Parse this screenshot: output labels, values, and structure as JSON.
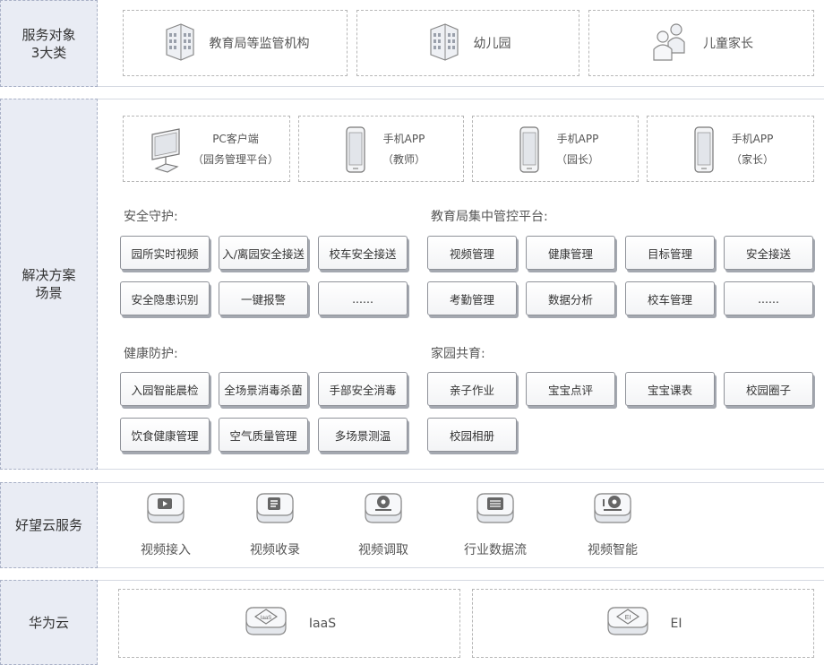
{
  "rows": {
    "targets": "服务对象\n3大类",
    "solutions": "解决方案\n场景",
    "cloud_service": "好望云服务",
    "huawei": "华为云"
  },
  "targets": [
    {
      "label": "教育局等监管机构",
      "icon": "building-icon"
    },
    {
      "label": "幼儿园",
      "icon": "building-icon"
    },
    {
      "label": "儿童家长",
      "icon": "people-icon"
    }
  ],
  "devices": [
    {
      "line1": "PC客户端",
      "line2": "（园务管理平台）",
      "icon": "monitor-icon"
    },
    {
      "line1": "手机APP",
      "line2": "（教师）",
      "icon": "phone-icon"
    },
    {
      "line1": "手机APP",
      "line2": "（园长）",
      "icon": "phone-icon"
    },
    {
      "line1": "手机APP",
      "line2": "（家长）",
      "icon": "phone-icon"
    }
  ],
  "safety": {
    "title": "安全守护:",
    "items": [
      "园所实时视频",
      "入/离园安全接送",
      "校车安全接送",
      "安全隐患识别",
      "一键报警",
      "......"
    ]
  },
  "bureau": {
    "title": "教育局集中管控平台:",
    "items": [
      "视频管理",
      "健康管理",
      "目标管理",
      "安全接送",
      "考勤管理",
      "数据分析",
      "校车管理",
      "......"
    ]
  },
  "health": {
    "title": "健康防护:",
    "items": [
      "入园智能晨检",
      "全场景消毒杀菌",
      "手部安全消毒",
      "饮食健康管理",
      "空气质量管理",
      "多场景测温"
    ]
  },
  "homeschool": {
    "title": "家园共育:",
    "items": [
      "亲子作业",
      "宝宝点评",
      "宝宝课表",
      "校园圈子",
      "校园相册"
    ]
  },
  "services": [
    {
      "label": "视频接入",
      "icon": "video-access-icon"
    },
    {
      "label": "视频收录",
      "icon": "video-record-icon"
    },
    {
      "label": "视频调取",
      "icon": "video-retrieve-icon"
    },
    {
      "label": "行业数据流",
      "icon": "data-flow-icon"
    },
    {
      "label": "视频智能",
      "icon": "video-ai-icon"
    }
  ],
  "huawei_items": [
    {
      "label": "IaaS",
      "icon": "iaas-icon"
    },
    {
      "label": "EI",
      "icon": "ei-icon"
    }
  ]
}
